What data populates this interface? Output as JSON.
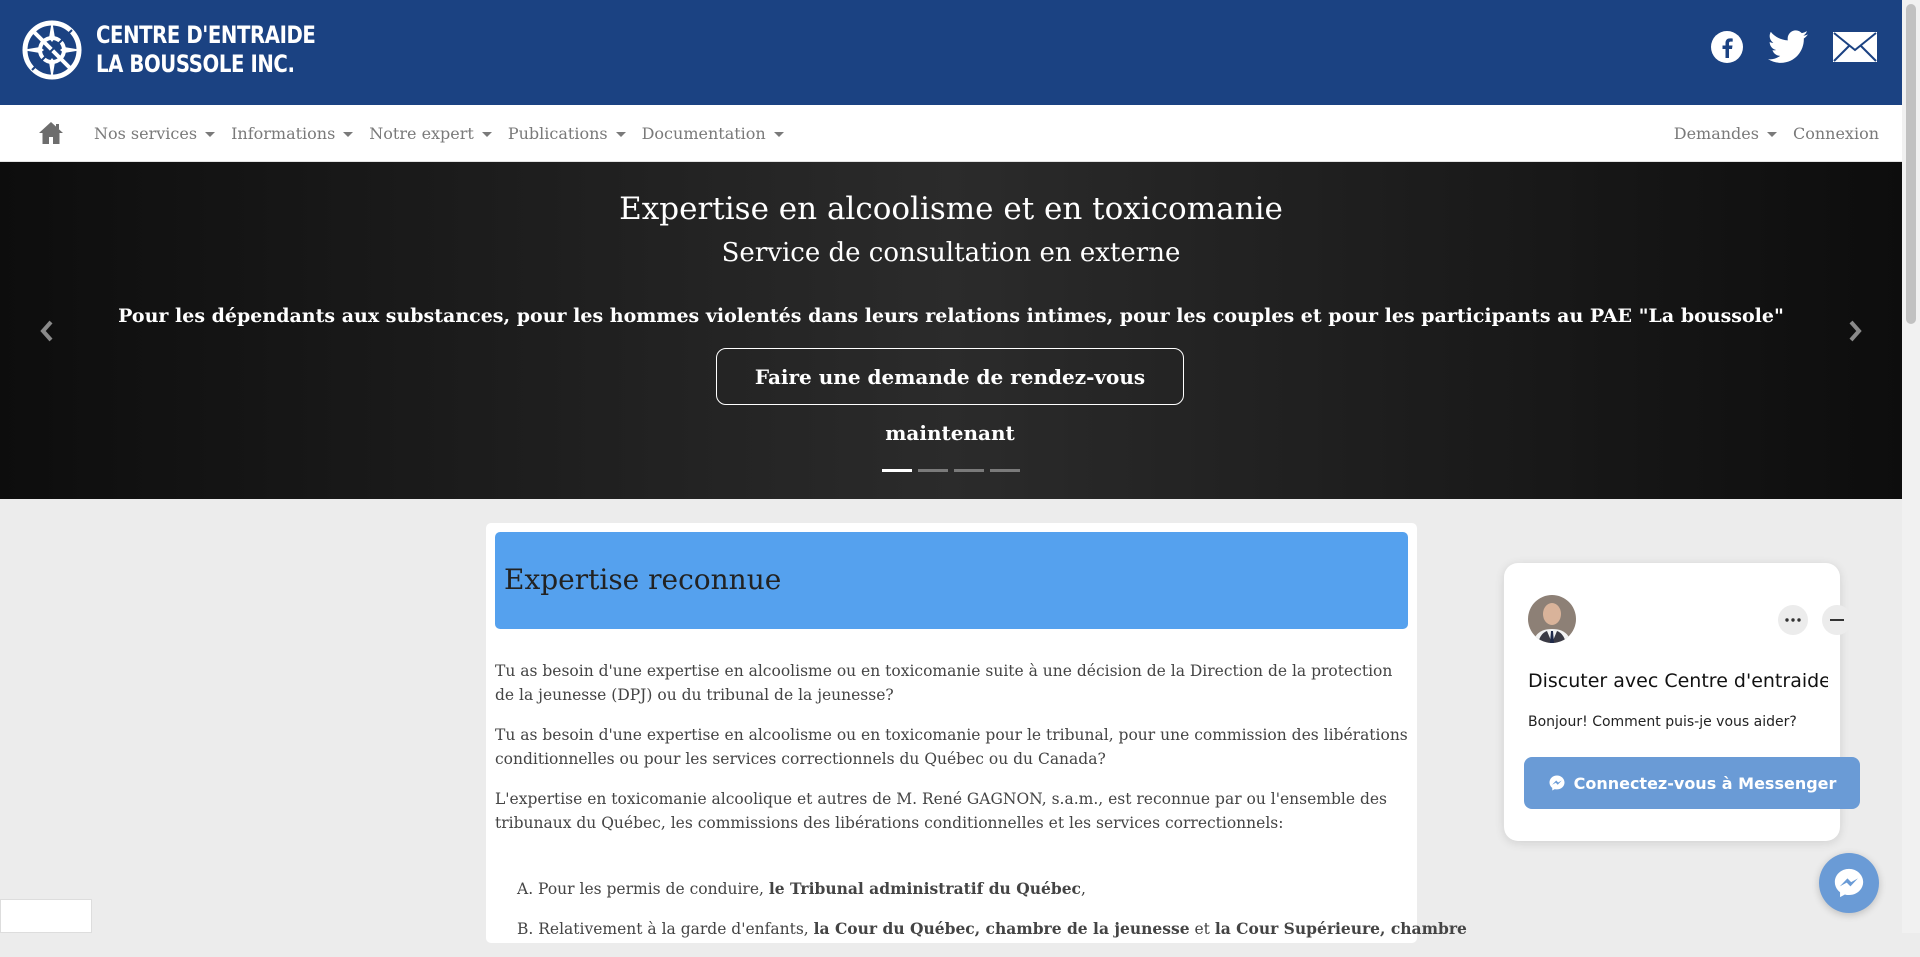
{
  "header": {
    "logo_line1": "CENTRE D'ENTRAIDE",
    "logo_line2": "LA BOUSSOLE INC.",
    "social": [
      "facebook-icon",
      "twitter-icon",
      "mail-icon"
    ]
  },
  "nav": {
    "left": [
      {
        "label": "Nos services"
      },
      {
        "label": "Informations"
      },
      {
        "label": "Notre expert"
      },
      {
        "label": "Publications"
      },
      {
        "label": "Documentation"
      }
    ],
    "right": [
      {
        "label": "Demandes"
      },
      {
        "label": "Connexion"
      }
    ]
  },
  "hero": {
    "title": "Expertise en alcoolisme et en toxicomanie",
    "subtitle": "Service de consultation en externe",
    "description": "Pour les dépendants aux substances, pour les hommes violentés dans leurs relations intimes, pour les couples et pour les participants au PAE \"La boussole\"",
    "cta": "Faire une demande de rendez-vous maintenant",
    "slide_count": 4,
    "active_slide": 1
  },
  "content": {
    "heading": "Expertise reconnue",
    "paragraphs": [
      "Tu as besoin d'une expertise en alcoolisme ou en toxicomanie suite à une décision de la Direction de la protection de la jeunesse (DPJ) ou du tribunal de la jeunesse?",
      "Tu as besoin d'une expertise en alcoolisme ou en toxicomanie pour le tribunal, pour une commission des libérations conditionnelles ou pour les services correctionnels du Québec ou du Canada?",
      "L'expertise en toxicomanie alcoolique et autres de M. René GAGNON, s.a.m., est reconnue par ou l'ensemble des tribunaux du Québec, les commissions des libérations conditionnelles et les services correctionnels:"
    ],
    "list": [
      {
        "prefix": "A. Pour les permis de conduire, ",
        "bold1": "le Tribunal administratif du Québec",
        "mid": ",",
        "bold2": ""
      },
      {
        "prefix": "B. Relativement à la garde d'enfants, ",
        "bold1": "la Cour du Québec, chambre de la jeunesse",
        "mid": " et ",
        "bold2": "la Cour Supérieure, chambre"
      }
    ]
  },
  "chat": {
    "title": "Discuter avec Centre d'entraide L...",
    "greeting": "Bonjour! Comment puis-je vous aider?",
    "button": "Connectez-vous à Messenger"
  }
}
